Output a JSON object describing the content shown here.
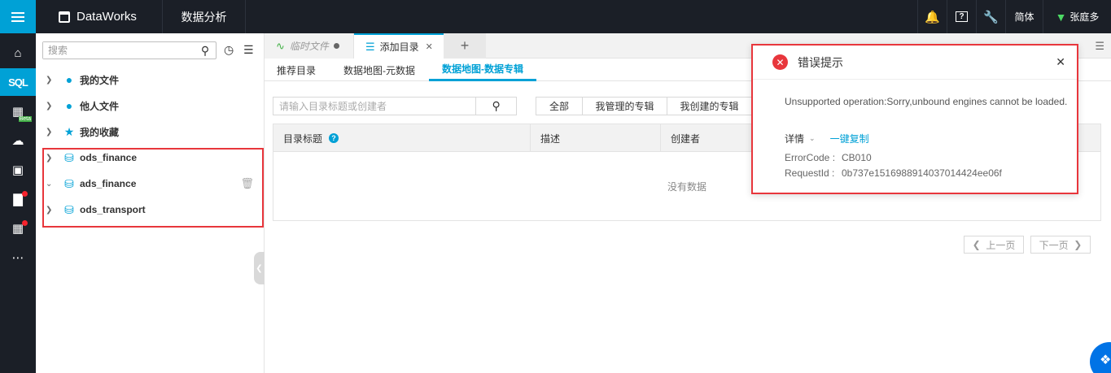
{
  "topbar": {
    "brand": "DataWorks",
    "module": "数据分析",
    "lang": "简体",
    "user": "张庭多",
    "icons": [
      "bell-icon",
      "help-icon",
      "wrench-icon"
    ]
  },
  "leftnav": {
    "items": [
      "home-icon",
      "sql-icon",
      "data-map-icon",
      "upload-icon",
      "report-icon",
      "chart-icon",
      "apps-icon",
      "more-icon"
    ],
    "sql_label": "SQL",
    "beta_label": "Beta"
  },
  "tree": {
    "search_placeholder": "搜索",
    "items": [
      {
        "label": "我的文件",
        "icon": "user-icon"
      },
      {
        "label": "他人文件",
        "icon": "users-icon"
      },
      {
        "label": "我的收藏",
        "icon": "star-icon"
      },
      {
        "label": "ods_finance",
        "icon": "database-icon"
      },
      {
        "label": "ads_finance",
        "icon": "database-icon"
      },
      {
        "label": "ods_transport",
        "icon": "database-icon"
      }
    ]
  },
  "tabs": {
    "temp": "临时文件",
    "add_dir": "添加目录",
    "add": "+"
  },
  "subtabs": [
    "推荐目录",
    "数据地图-元数据",
    "数据地图-数据专辑"
  ],
  "dir": {
    "search_placeholder": "请输入目录标题或创建者",
    "filters": [
      "全部",
      "我管理的专辑",
      "我创建的专辑"
    ],
    "columns": [
      "目录标题",
      "描述",
      "创建者"
    ],
    "empty": "没有数据",
    "prev": "上一页",
    "next": "下一页"
  },
  "error": {
    "title": "错误提示",
    "message": "Unsupported operation:Sorry,unbound engines cannot be loaded.",
    "detail_label": "详情",
    "copy_label": "一键复制",
    "error_code_label": "ErrorCode :",
    "error_code": "CB010",
    "request_id_label": "RequestId :",
    "request_id": "0b737e1516988914037014424ee06f"
  },
  "colors": {
    "accent": "#00a1d6",
    "topbar_bg": "#1b1f27",
    "error_red": "#e8363c"
  }
}
